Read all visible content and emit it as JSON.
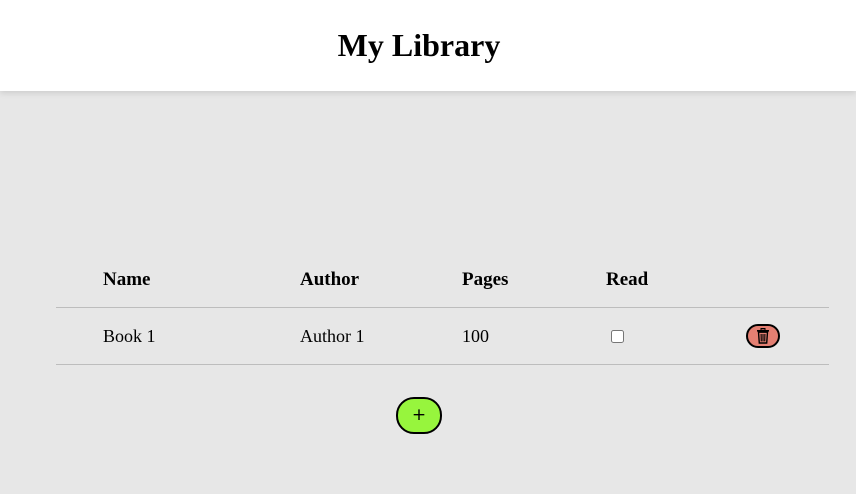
{
  "header": {
    "title": "My Library"
  },
  "table": {
    "columns": [
      "Name",
      "Author",
      "Pages",
      "Read"
    ],
    "rows": [
      {
        "name": "Book 1",
        "author": "Author 1",
        "pages": "100",
        "read": false,
        "delete_icon": "trash-icon"
      }
    ]
  },
  "actions": {
    "add_label": "+"
  },
  "colors": {
    "header_bg": "#ffffff",
    "page_bg": "#e7e7e7",
    "delete_button": "#e37f72",
    "add_button": "#97f53d"
  }
}
